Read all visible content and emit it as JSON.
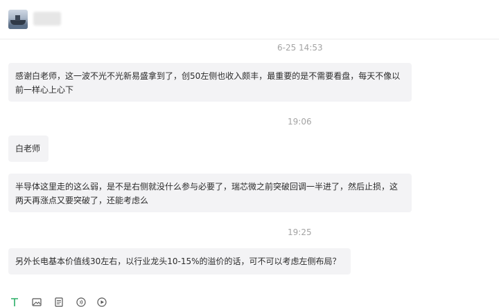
{
  "header": {
    "contact_name": ""
  },
  "messages": [
    {
      "type": "time",
      "text": "6-25 14:53"
    },
    {
      "type": "bubble",
      "text": "感谢白老师，这一波不光不光新易盛拿到了，创50左侧也收入颇丰，最重要的是不需要看盘，每天不像以前一样心上心下"
    },
    {
      "type": "time",
      "text": "19:06"
    },
    {
      "type": "bubble",
      "text": "白老师"
    },
    {
      "type": "bubble",
      "text": "半导体这里走的这么弱，是不是右侧就没什么参与必要了，瑞芯微之前突破回调一半进了，然后止损，这两天再涨点又要突破了，还能考虑么"
    },
    {
      "type": "time",
      "text": "19:25"
    },
    {
      "type": "bubble",
      "text": "另外长电基本价值线30左右，以行业龙头10-15%的溢价的话，可不可以考虑左侧布局？"
    }
  ],
  "toolbar": {
    "items": [
      {
        "icon": "text-format-icon",
        "color": "#2aae67"
      },
      {
        "icon": "image-icon",
        "color": "#555555"
      },
      {
        "icon": "document-icon",
        "color": "#555555"
      },
      {
        "icon": "voice-icon",
        "color": "#555555"
      },
      {
        "icon": "video-play-icon",
        "color": "#555555"
      }
    ]
  }
}
